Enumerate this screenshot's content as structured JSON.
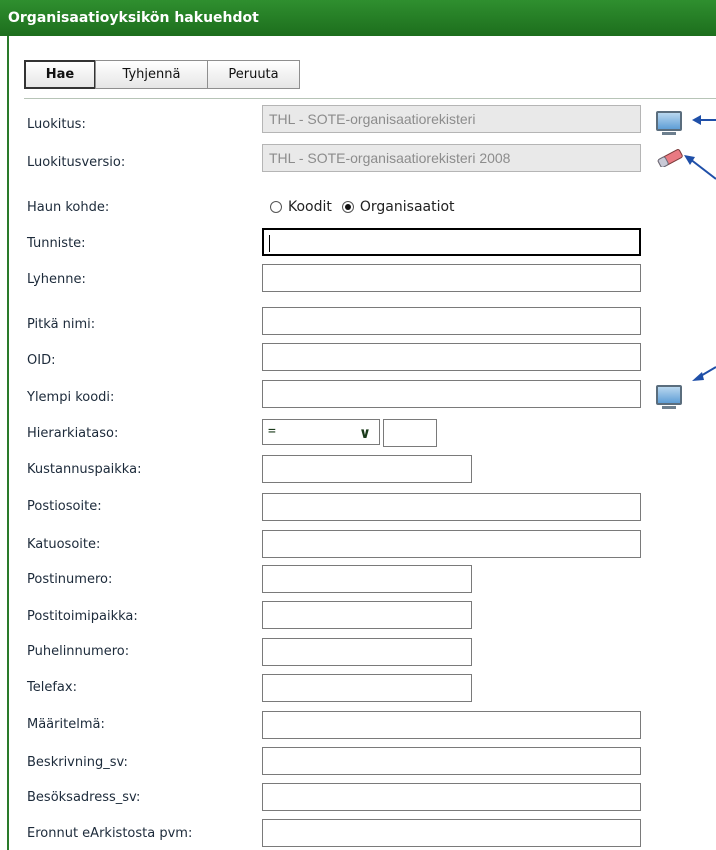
{
  "header": {
    "title": "Organisaatioyksikön hakuehdot"
  },
  "toolbar": {
    "search": "Hae",
    "clear": "Tyhjennä",
    "cancel": "Peruuta"
  },
  "fields": {
    "luokitus": {
      "label": "Luokitus:",
      "value": "THL - SOTE-organisaatiorekisteri"
    },
    "luokitusversio": {
      "label": "Luokitusversio:",
      "value": "THL - SOTE-organisaatiorekisteri 2008"
    },
    "haun_kohde": {
      "label": "Haun kohde:",
      "option_codes": "Koodit",
      "option_orgs": "Organisaatiot",
      "selected": "Organisaatiot"
    },
    "tunniste": {
      "label": "Tunniste:",
      "value": ""
    },
    "lyhenne": {
      "label": "Lyhenne:",
      "value": ""
    },
    "pitka_nimi": {
      "label": "Pitkä nimi:",
      "value": ""
    },
    "oid": {
      "label": "OID:",
      "value": ""
    },
    "ylempi_koodi": {
      "label": "Ylempi koodi:",
      "value": ""
    },
    "hierarkiataso": {
      "label": "Hierarkiataso:",
      "operator": "=",
      "value": ""
    },
    "kustannuspaikka": {
      "label": "Kustannuspaikka:",
      "value": ""
    },
    "postiosoite": {
      "label": "Postiosoite:",
      "value": ""
    },
    "katuosoite": {
      "label": "Katuosoite:",
      "value": ""
    },
    "postinumero": {
      "label": "Postinumero:",
      "value": ""
    },
    "postitoimipaikka": {
      "label": "Postitoimipaikka:",
      "value": ""
    },
    "puhelinnumero": {
      "label": "Puhelinnumero:",
      "value": ""
    },
    "telefax": {
      "label": "Telefax:",
      "value": ""
    },
    "maaritelma": {
      "label": "Määritelmä:",
      "value": ""
    },
    "beskrivning_sv": {
      "label": "Beskrivning_sv:",
      "value": ""
    },
    "besoksadress_sv": {
      "label": "Besöksadress_sv:",
      "value": ""
    },
    "eronnut": {
      "label": "Eronnut eArkistosta pvm:",
      "value": ""
    }
  },
  "icons": {
    "browse": "monitor-icon",
    "clear_field": "eraser-icon",
    "annotation": "arrow-icon"
  },
  "colors": {
    "header": "#1d6e1d",
    "arrow": "#1f4fa8"
  }
}
